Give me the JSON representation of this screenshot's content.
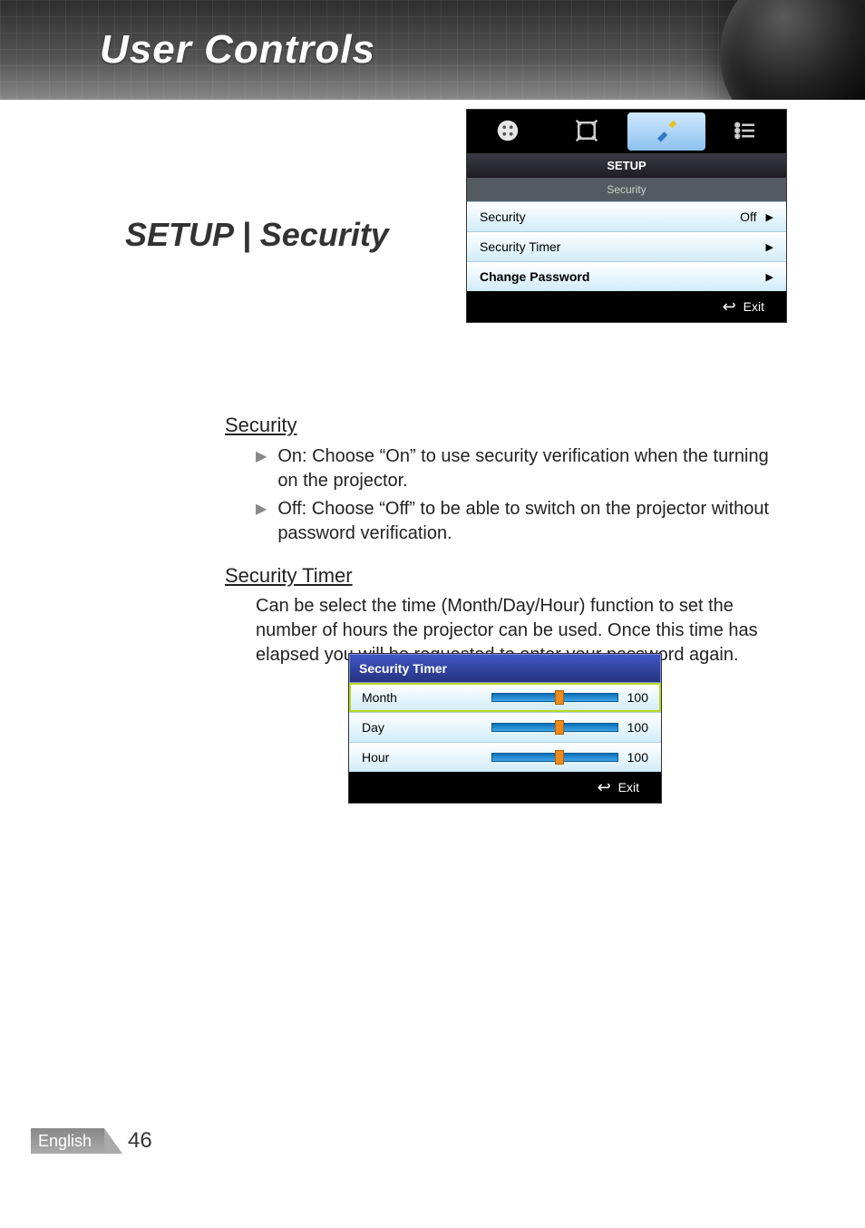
{
  "banner_title": "User Controls",
  "section_title": "SETUP | Security",
  "osd1": {
    "tab_title": "SETUP",
    "subtitle": "Security",
    "rows": {
      "security": {
        "label": "Security",
        "value": "Off"
      },
      "security_timer": {
        "label": "Security Timer"
      },
      "change_password": {
        "label": "Change Password"
      }
    },
    "exit_label": "Exit"
  },
  "body": {
    "h1": "Security",
    "b1": "On: Choose “On” to use security verification when the turning on the projector.",
    "b2": "Off: Choose “Off” to be able to switch on the projector without password verification.",
    "h2": "Security Timer",
    "p2": "Can be select the time (Month/Day/Hour) function to set the number of hours the projector can be used. Once this time has elapsed you will be requested to enter your password again."
  },
  "osd2": {
    "header": "Security Timer",
    "rows": {
      "month": {
        "label": "Month",
        "value": "100"
      },
      "day": {
        "label": "Day",
        "value": "100"
      },
      "hour": {
        "label": "Hour",
        "value": "100"
      }
    },
    "exit_label": "Exit"
  },
  "footer": {
    "language": "English",
    "page": "46"
  }
}
